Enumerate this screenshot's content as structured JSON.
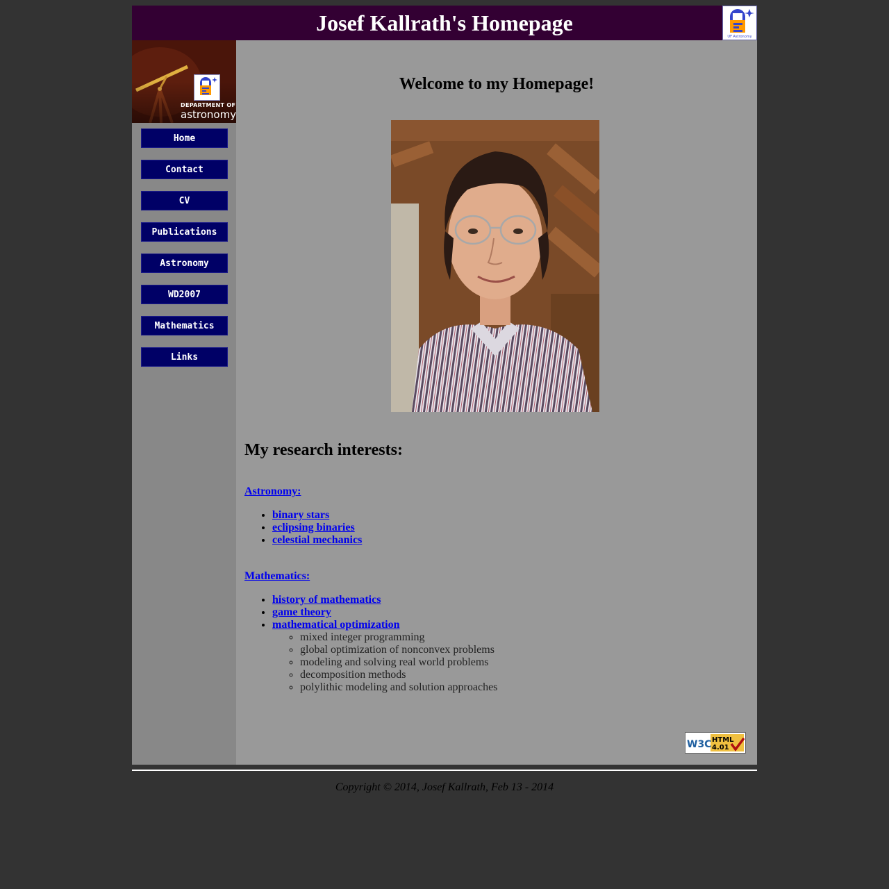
{
  "header": {
    "title": "Josef Kallrath's Homepage",
    "logo_icon": "uf-astronomy-logo-icon",
    "logo_text": "UF Astronomy"
  },
  "sidebar": {
    "banner": {
      "line1": "DEPARTMENT OF",
      "line2": "astronomy",
      "icon": "telescope-icon"
    },
    "nav": [
      {
        "label": "Home"
      },
      {
        "label": "Contact"
      },
      {
        "label": "CV"
      },
      {
        "label": "Publications"
      },
      {
        "label": "Astronomy"
      },
      {
        "label": "WD2007"
      },
      {
        "label": "Mathematics"
      },
      {
        "label": "Links"
      }
    ]
  },
  "main": {
    "welcome": "Welcome to my Homepage!",
    "research_heading": "My research interests:",
    "astronomy": {
      "label": "Astronomy:",
      "items": [
        "binary stars",
        "eclipsing binaries",
        "celestial mechanics"
      ]
    },
    "mathematics": {
      "label": "Mathematics:",
      "items": [
        "history of mathematics",
        "game theory",
        "mathematical optimization"
      ],
      "optimization_subitems": [
        "mixed integer programming",
        "global optimization of nonconvex problems",
        "modeling and solving real world problems",
        "decomposition methods",
        "polylithic modeling and solution approaches"
      ]
    },
    "badge": {
      "w3c": "W3C",
      "html": "HTML",
      "version": "4.01"
    }
  },
  "footer": {
    "copyright": "Copyright © 2014, Josef Kallrath, Feb 13 - 2014"
  },
  "colors": {
    "page_bg": "#333333",
    "header_bg": "#330033",
    "sidebar_bg": "#888888",
    "content_bg": "#999999",
    "nav_bg": "#000066",
    "link": "#0000ee"
  }
}
